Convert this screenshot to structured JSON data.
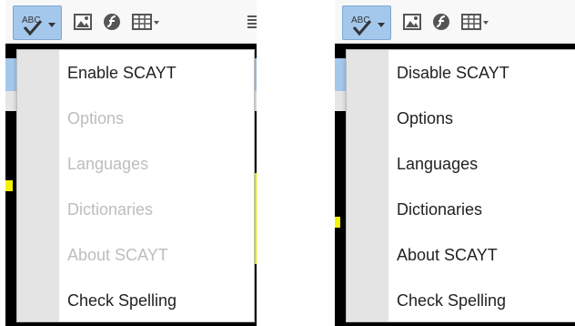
{
  "colors": {
    "toolbar_bg": "#f8f8f8",
    "scayt_button_bg": "#a4c8ec",
    "menu_gutter": "#e4e4e4",
    "enabled_text": "#222222",
    "disabled_text": "#bdbdbd",
    "editor_highlight": "#f4f400"
  },
  "toolbar": {
    "icons": [
      "spellcheck-icon",
      "image-icon",
      "flash-icon",
      "table-icon",
      "paragraph-icon"
    ],
    "scayt_label": "ABC"
  },
  "left_menu": {
    "items": [
      {
        "label": "Enable SCAYT",
        "enabled": true
      },
      {
        "label": "Options",
        "enabled": false
      },
      {
        "label": "Languages",
        "enabled": false
      },
      {
        "label": "Dictionaries",
        "enabled": false
      },
      {
        "label": "About SCAYT",
        "enabled": false
      },
      {
        "label": "Check Spelling",
        "enabled": true
      }
    ]
  },
  "right_menu": {
    "items": [
      {
        "label": "Disable SCAYT",
        "enabled": true
      },
      {
        "label": "Options",
        "enabled": true
      },
      {
        "label": "Languages",
        "enabled": true
      },
      {
        "label": "Dictionaries",
        "enabled": true
      },
      {
        "label": "About SCAYT",
        "enabled": true
      },
      {
        "label": "Check Spelling",
        "enabled": true
      }
    ]
  }
}
